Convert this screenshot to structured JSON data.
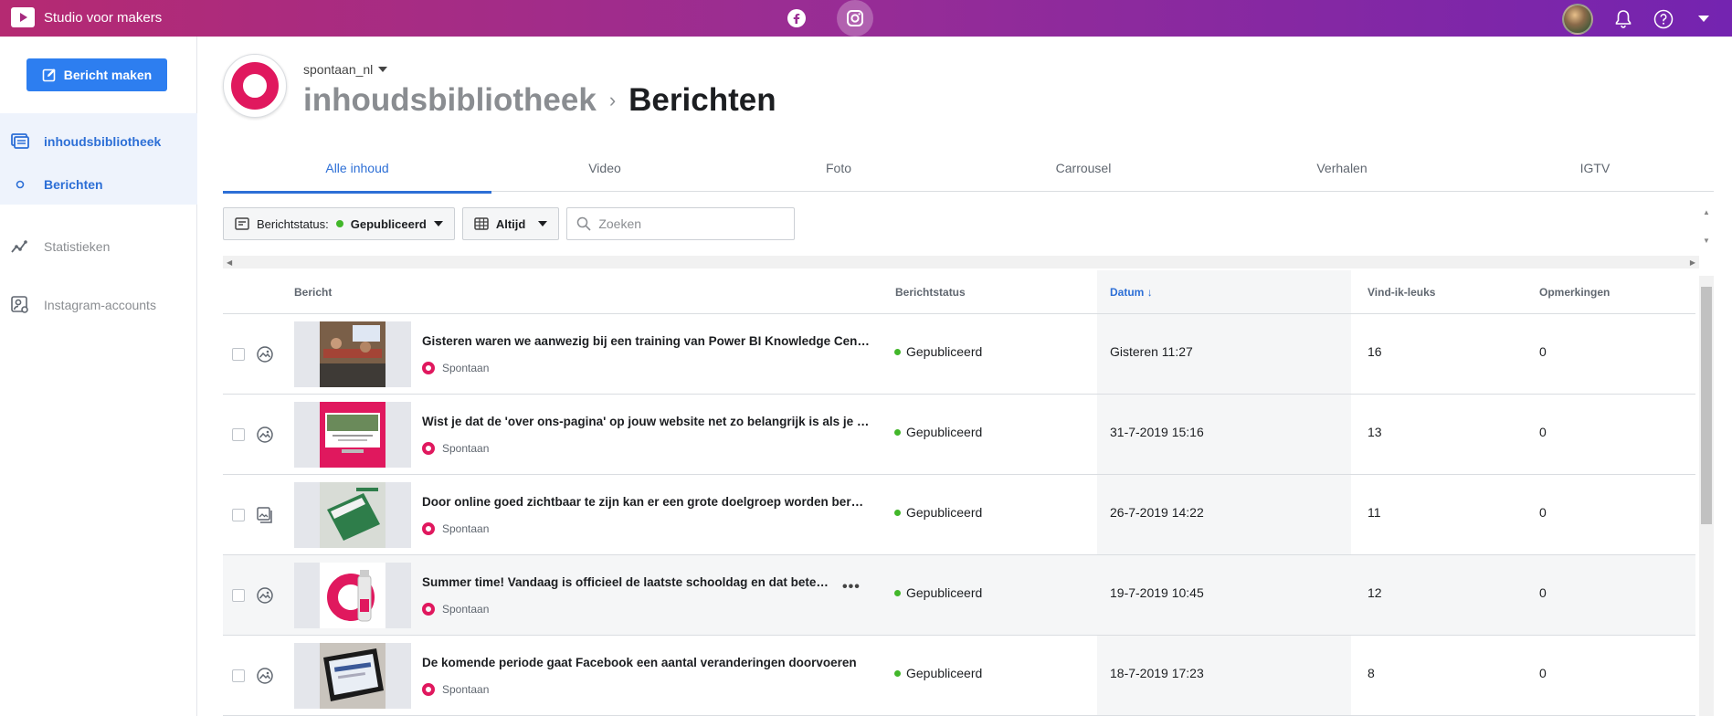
{
  "topbar": {
    "app_title": "Studio voor makers",
    "platforms": [
      "facebook-icon",
      "instagram-icon"
    ],
    "active_platform": "instagram"
  },
  "sidebar": {
    "create_button": "Bericht maken",
    "items": [
      {
        "label": "inhoudsbibliotheek",
        "icon": "library-icon",
        "active": true
      },
      {
        "label": "Berichten",
        "icon": "circle-icon",
        "active": true
      },
      {
        "label": "Statistieken",
        "icon": "chart-line-icon",
        "active": false
      },
      {
        "label": "Instagram-accounts",
        "icon": "account-settings-icon",
        "active": false
      }
    ]
  },
  "header": {
    "account": "spontaan_nl",
    "breadcrumb_parent": "inhoudsbibliotheek",
    "breadcrumb_current": "Berichten",
    "brand_color": "#e0185e"
  },
  "tabs": [
    "Alle inhoud",
    "Video",
    "Foto",
    "Carrousel",
    "Verhalen",
    "IGTV"
  ],
  "filters": {
    "status_label": "Berichtstatus:",
    "status_value": "Gepubliceerd",
    "period": "Altijd",
    "search_placeholder": "Zoeken"
  },
  "table": {
    "columns": [
      "Bericht",
      "Berichtstatus",
      "Datum",
      "Vind-ik-leuks",
      "Opmerkingen"
    ],
    "sort_column": "Datum",
    "rows": [
      {
        "title": "Gisteren waren we aanwezig bij een training van Power BI Knowledge Center",
        "account": "Spontaan",
        "status": "Gepubliceerd",
        "date": "Gisteren 11:27",
        "likes": "16",
        "comments": "0",
        "type": "photo"
      },
      {
        "title": "Wist je dat de 'over ons-pagina' op jouw website net zo belangrijk is als je homepage",
        "account": "Spontaan",
        "status": "Gepubliceerd",
        "date": "31-7-2019 15:16",
        "likes": "13",
        "comments": "0",
        "type": "photo"
      },
      {
        "title": "Door online goed zichtbaar te zijn kan er een grote doelgroep worden bereikt",
        "account": "Spontaan",
        "status": "Gepubliceerd",
        "date": "26-7-2019 14:22",
        "likes": "11",
        "comments": "0",
        "type": "carousel"
      },
      {
        "title": "Summer time! Vandaag is officieel de laatste schooldag en dat betekent zomervakantie",
        "account": "Spontaan",
        "status": "Gepubliceerd",
        "date": "19-7-2019 10:45",
        "likes": "12",
        "comments": "0",
        "type": "photo"
      },
      {
        "title": "De komende periode gaat Facebook een aantal veranderingen doorvoeren",
        "account": "Spontaan",
        "status": "Gepubliceerd",
        "date": "18-7-2019 17:23",
        "likes": "8",
        "comments": "0",
        "type": "photo"
      }
    ]
  }
}
